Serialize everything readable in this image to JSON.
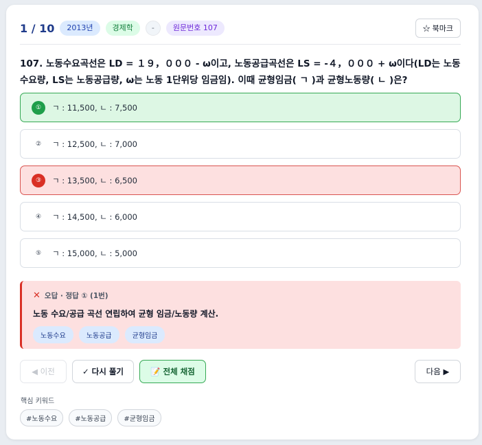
{
  "header": {
    "counter": "1 / 10",
    "year_tag": "2013년",
    "subject_tag": "경제학",
    "dash_tag": "-",
    "original_tag": "원문번호 107",
    "bookmark_label": "☆ 북마크"
  },
  "question": {
    "text": "107. 노동수요곡선은 LD = １９，０００ - ω이고, 노동공급곡선은 LS = -４，０００ + ω이다(LD는 노동수요량, LS는 노동공급량, ω는 노동 1단위당 임금임). 이때 균형임금( ㄱ )과 균형노동량( ㄴ )은?"
  },
  "options": [
    {
      "num": "①",
      "text": "ㄱ : 11,500,  ㄴ : 7,500",
      "state": "correct"
    },
    {
      "num": "②",
      "text": "ㄱ : 12,500,  ㄴ : 7,000",
      "state": "normal"
    },
    {
      "num": "③",
      "text": "ㄱ : 13,500,  ㄴ : 6,500",
      "state": "wrong"
    },
    {
      "num": "④",
      "text": "ㄱ : 14,500,  ㄴ : 6,000",
      "state": "normal"
    },
    {
      "num": "⑤",
      "text": "ㄱ : 15,000,  ㄴ : 5,000",
      "state": "normal"
    }
  ],
  "feedback": {
    "icon": "✕",
    "status": "오답 · 정답 ① (1번)",
    "explanation": "노동 수요/공급 곡선 연립하여 균형 임금/노동량 계산.",
    "tags": [
      "노동수요",
      "노동공급",
      "균형임금"
    ]
  },
  "actions": {
    "prev_label": "◀ 이전",
    "retry_label": "✓ 다시 풀기",
    "grade_label": "📝 전체 채점",
    "next_label": "다음 ▶"
  },
  "keywords": {
    "title": "핵심 키워드",
    "items": [
      "#노동수요",
      "#노동공급",
      "#균형임금"
    ]
  },
  "colors": {
    "correct_bg": "#ddf7e4",
    "correct_border": "#34a853",
    "wrong_bg": "#fde0e0",
    "wrong_border": "#d93025",
    "accent": "#1e3a8a"
  }
}
